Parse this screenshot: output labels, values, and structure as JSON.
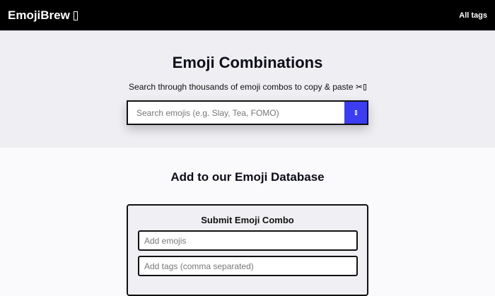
{
  "header": {
    "brand": "EmojiBrew",
    "brand_icon": "missing-glyph-icon",
    "nav_link": "All tags"
  },
  "hero": {
    "title": "Emoji Combinations",
    "subtitle": "Search through thousands of emoji combos to copy & paste ✂",
    "search": {
      "placeholder": "Search emojis (e.g. Slay, Tea, FOMO)",
      "value": "",
      "button_icon": "search-icon"
    }
  },
  "submit_section": {
    "title": "Add to our Emoji Database",
    "form": {
      "title": "Submit Emoji Combo",
      "emoji_placeholder": "Add emojis",
      "tags_placeholder": "Add tags (comma separated)"
    }
  },
  "colors": {
    "header_bg": "#000000",
    "hero_bg": "#efeff3",
    "page_bg": "#fafafc",
    "accent": "#3c3cf0"
  }
}
